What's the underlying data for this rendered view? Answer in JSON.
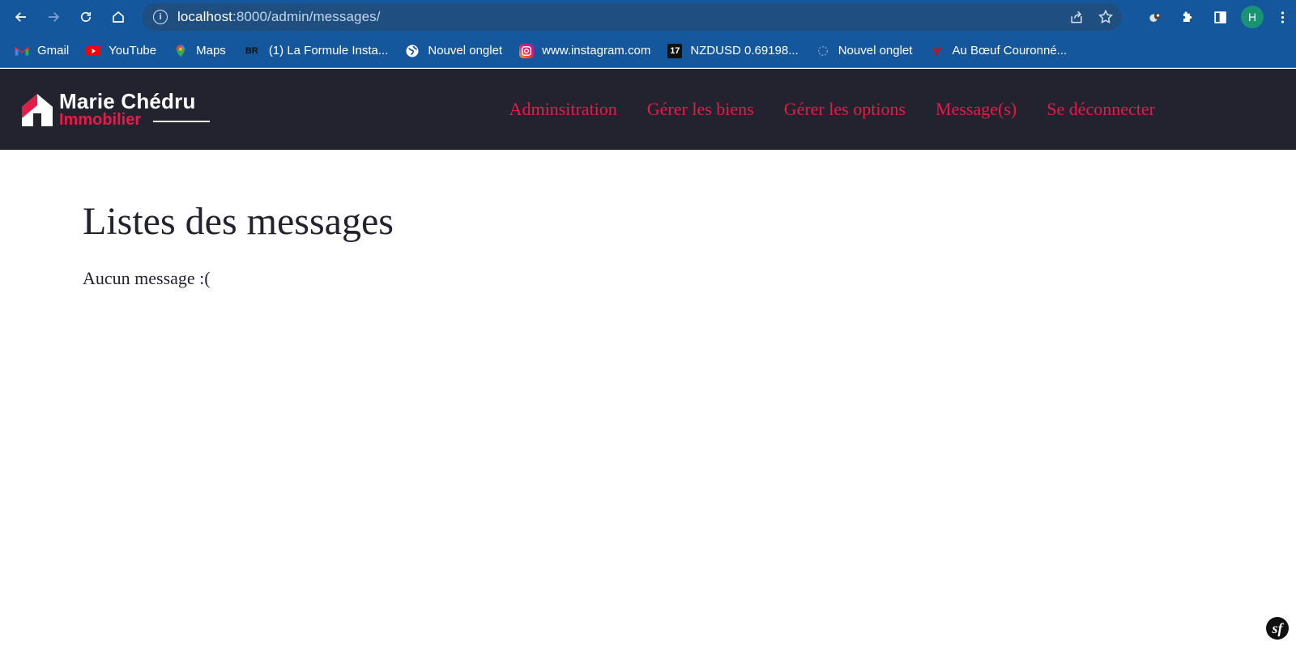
{
  "browser": {
    "url_host": "localhost",
    "url_rest": ":8000/admin/messages/",
    "profile_initial": "H",
    "bookmarks": [
      {
        "icon": "gmail-icon",
        "label": "Gmail"
      },
      {
        "icon": "youtube-icon",
        "label": "YouTube"
      },
      {
        "icon": "maps-icon",
        "label": "Maps"
      },
      {
        "icon": "br-icon",
        "icon_text": "BR",
        "label": "(1) La Formule Insta..."
      },
      {
        "icon": "globe-icon",
        "label": "Nouvel onglet"
      },
      {
        "icon": "instagram-icon",
        "label": "www.instagram.com"
      },
      {
        "icon": "tradingview-icon",
        "icon_text": "17",
        "label": "NZDUSD 0.69198..."
      },
      {
        "icon": "page-icon",
        "label": "Nouvel onglet"
      },
      {
        "icon": "restaurant-icon",
        "label": "Au Bœuf Couronné..."
      }
    ]
  },
  "site": {
    "logo_name": "Marie Chédru",
    "logo_sub": "Immobilier",
    "nav": [
      "Adminsitration",
      "Gérer les biens",
      "Gérer les options",
      "Message(s)",
      "Se déconnecter"
    ],
    "accent_color": "#e11d48",
    "header_bg": "#23232f"
  },
  "main": {
    "title": "Listes des messages",
    "empty_message": "Aucun message :("
  },
  "debug_toolbar": {
    "label": "sf"
  }
}
